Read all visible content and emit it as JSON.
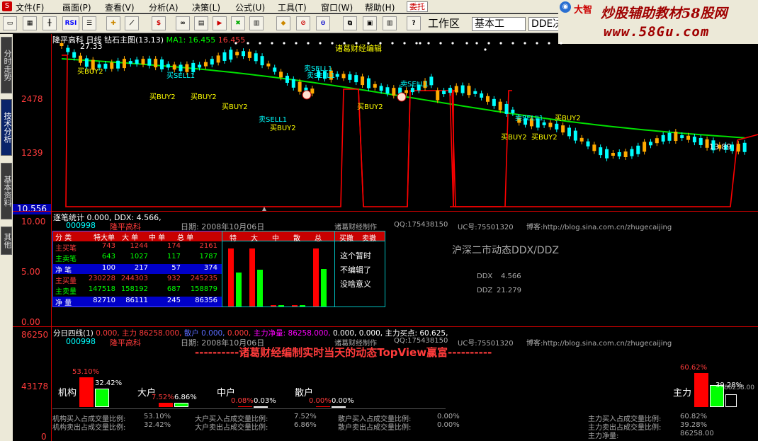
{
  "menu": {
    "items": [
      "文件(F)",
      "画面(P)",
      "查看(V)",
      "分析(A)",
      "决策(L)",
      "公式(U)",
      "工具(T)",
      "窗口(W)",
      "帮助(H)"
    ],
    "order_button": "委托"
  },
  "brand": {
    "text": "炒股辅助教材58股网",
    "url": "www.58Gu.com",
    "big": "大智"
  },
  "toolbar": {
    "rsi_label": "RSI",
    "workspace_label": "工作区",
    "workspace_value": "基本工",
    "ddx_label": "DDE决策",
    "extra": "主"
  },
  "sidetabs": [
    "分时走势",
    "技术分析",
    "基本资料",
    "其他"
  ],
  "price_panel": {
    "title_stock": "隆平高科",
    "title_period": "日线",
    "title_main": "钻石主图(13,13)",
    "ma_label": "MA1: 16.455",
    "ma_extra": "16.455",
    "top_label": "27.33",
    "low_label": "13.89",
    "center_label": "诸葛财经编辑",
    "y_labels": [
      "2478",
      "1239"
    ],
    "current_price": "10.556",
    "signals": [
      {
        "text": "买BUY2",
        "color": "#ffff00"
      },
      {
        "text": "买SELL1",
        "color": "#00ffff"
      },
      {
        "text": "买BUY2",
        "color": "#ffff00"
      },
      {
        "text": "买BUY2",
        "color": "#ffff00"
      },
      {
        "text": "买BUY2",
        "color": "#ffff00"
      },
      {
        "text": "卖SELL1",
        "color": "#00ffff"
      },
      {
        "text": "买BUY2",
        "color": "#ffff00"
      },
      {
        "text": "卖SELL1",
        "color": "#00ffff"
      },
      {
        "text": "卖SELL1",
        "color": "#00ffff"
      },
      {
        "text": "买BUY2",
        "color": "#ffff00"
      },
      {
        "text": "卖SELL1",
        "color": "#00ffff"
      },
      {
        "text": "卖SELL1",
        "color": "#00ffff"
      },
      {
        "text": "买BUY2",
        "color": "#ffff00"
      },
      {
        "text": "买BUY2",
        "color": "#ffff00"
      },
      {
        "text": "买BUY2",
        "color": "#ffff00"
      }
    ]
  },
  "ddx_panel": {
    "header": "逐笔统计 0.000, DDX: 4.566,",
    "y_labels": [
      "10.00",
      "5.00",
      "0.00"
    ],
    "code": "000998",
    "name": "隆平高科",
    "date": "日期: 2008年10月06日",
    "credit": "诸葛财经制作",
    "qq": "QQ:175438150",
    "uc": "UC号:75501320",
    "blog": "博客:http://blog.sina.com.cn/zhugecaijing",
    "table_headers": [
      "分 类",
      "特大单",
      "大 单",
      "中 单",
      "总 单"
    ],
    "table_rows": [
      {
        "label": "主买笔",
        "vals": [
          "743",
          "1244",
          "174",
          "2161"
        ],
        "color": "#ff3b3b",
        "bg": "#000"
      },
      {
        "label": "主卖笔",
        "vals": [
          "643",
          "1027",
          "117",
          "1787"
        ],
        "color": "#00ff00",
        "bg": "#000"
      },
      {
        "label": "净 笔",
        "vals": [
          "100",
          "217",
          "57",
          "374"
        ],
        "color": "#ffffff",
        "bg": "#0000c8"
      },
      {
        "label": "主买量",
        "vals": [
          "230228",
          "244303",
          "932",
          "245235"
        ],
        "color": "#ff3b3b",
        "bg": "#000"
      },
      {
        "label": "主卖量",
        "vals": [
          "147518",
          "158192",
          "687",
          "158879"
        ],
        "color": "#00ff00",
        "bg": "#000"
      },
      {
        "label": "净 量",
        "vals": [
          "82710",
          "86111",
          "245",
          "86356"
        ],
        "color": "#ffffff",
        "bg": "#0000c8"
      }
    ],
    "bar_headers": [
      "特",
      "大",
      "中",
      "散",
      "总"
    ],
    "bar_values": [
      {
        "buy": 0.93,
        "sell": 0.55
      },
      {
        "buy": 0.93,
        "sell": 0.59
      },
      {
        "buy": 0.02,
        "sell": 0.02
      },
      {
        "buy": 0.02,
        "sell": 0.02
      },
      {
        "buy": 0.93,
        "sell": 0.6
      }
    ],
    "note_headers": [
      "买撤",
      "卖撤"
    ],
    "notes": [
      "这个暂时",
      "不编辑了",
      "没啥意义"
    ],
    "market_title": "沪深二市动态DDX/DDZ",
    "ddx_label": "DDX",
    "ddx_value": "4.566",
    "ddz_label": "DDZ",
    "ddz_value": "21.279"
  },
  "bottom_panel": {
    "header_a": "分日四线(1)",
    "header_b": "0.000, 主力",
    "header_c": "86258.000,",
    "header_d": "散户",
    "header_e": "0.000,",
    "header_f": "0.000,",
    "header_g": "主力净量:",
    "header_h": "86258.000,",
    "header_i": "0.000, 0.000,",
    "header_j": "主力买点: 60.625,",
    "y_labels": [
      "86250",
      "43178",
      "0"
    ],
    "code": "000998",
    "name": "隆平高科",
    "date": "日期: 2008年10月06日",
    "credit": "诸葛财经制作",
    "qq": "QQ:175438150",
    "uc": "UC号:75501320",
    "blog": "博客:http://blog.sina.com.cn/zhugecaijing",
    "banner": "----------诸葛财经编制实时当天的动态TopView赢富----------",
    "groups": [
      {
        "name": "机构",
        "buy_pct": "53.10%",
        "sell_pct": "32.42%",
        "buy": 0.531,
        "sell": 0.324
      },
      {
        "name": "大户",
        "buy_pct": "7.52%",
        "sell_pct": "6.86%",
        "buy": 0.075,
        "sell": 0.069
      },
      {
        "name": "中户",
        "buy_pct": "0.08%",
        "sell_pct": "0.03%",
        "buy": 0.001,
        "sell": 0.0005
      },
      {
        "name": "散户",
        "buy_pct": "0.00%",
        "sell_pct": "0.00%",
        "buy": 0,
        "sell": 0
      }
    ],
    "main_force": {
      "name": "主力",
      "buy_pct": "60.62%",
      "sell_pct": "39.28%",
      "net_text": "86258.00",
      "buy": 0.606,
      "sell": 0.393
    },
    "stats_left": [
      {
        "label": "机构买入占成交量比例:",
        "value": "53.10%"
      },
      {
        "label": "机构卖出占成交量比例:",
        "value": "32.42%"
      }
    ],
    "stats_mid": [
      {
        "label": "大户买入占成交量比例:",
        "value": "7.52%"
      },
      {
        "label": "大户卖出占成交量比例:",
        "value": "6.86%"
      }
    ],
    "stats_right": [
      {
        "label": "散户买入占成交量比例:",
        "value": "0.00%"
      },
      {
        "label": "散户卖出占成交量比例:",
        "value": "0.00%"
      }
    ],
    "stats_main": [
      {
        "label": "主力买入占成交量比例:",
        "value": "60.82%"
      },
      {
        "label": "主力卖出占成交量比例:",
        "value": "39.28%"
      },
      {
        "label": "主力净量:",
        "value": "86258.00"
      }
    ]
  },
  "colors": {
    "up": "#ff3b3b",
    "down": "#00ffff",
    "ma": "#00e000",
    "buy": "#ff0000",
    "sell": "#00ff00",
    "axis": "#cc0000"
  }
}
